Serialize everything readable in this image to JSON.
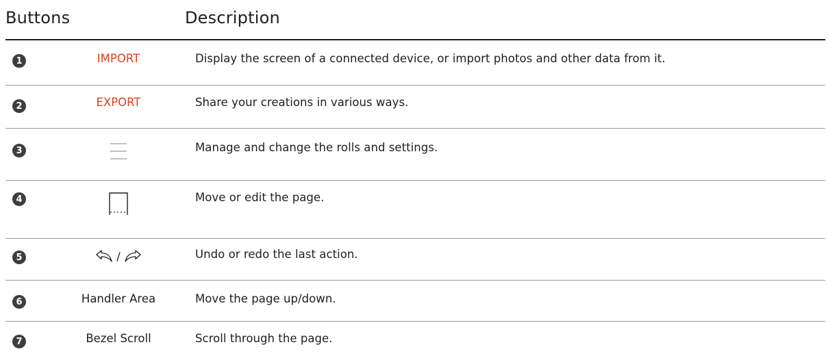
{
  "header": {
    "buttons_label": "Buttons",
    "description_label": "Description"
  },
  "rows": [
    {
      "number": "1",
      "button": "IMPORT",
      "button_is_text": true,
      "description": "Display the screen of a connected device, or import photos and other data from it."
    },
    {
      "number": "2",
      "button": "EXPORT",
      "button_is_text": true,
      "description": "Share your creations in various ways."
    },
    {
      "number": "3",
      "button_icon": "menu-lines-icon",
      "button_is_text": false,
      "description": "Manage and change the rolls and settings."
    },
    {
      "number": "4",
      "button_icon": "page-bracket-icon",
      "button_is_text": false,
      "description": "Move or edit the page."
    },
    {
      "number": "5",
      "button_icon": "undo-redo-icon",
      "separator": "/",
      "button_is_text": false,
      "description": "Undo or redo the last action."
    },
    {
      "number": "6",
      "button": "Handler Area",
      "button_is_text": true,
      "description": "Move the page up/down."
    },
    {
      "number": "7",
      "button": "Bezel Scroll",
      "button_is_text": true,
      "description": "Scroll through the page."
    }
  ],
  "colors": {
    "accent": "#d9441c",
    "badge": "#3e3e3e",
    "text": "#1e1e1e",
    "rule": "#9a9a9a"
  }
}
